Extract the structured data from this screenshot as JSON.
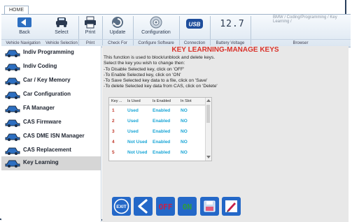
{
  "window": {
    "tab_title": "HOME"
  },
  "ribbon": {
    "buttons": [
      {
        "label": "Back",
        "icon": "back-arrow-icon"
      },
      {
        "label": "Select",
        "icon": "car-icon"
      },
      {
        "label": "Print",
        "icon": "printer-icon"
      },
      {
        "label": "Update",
        "icon": "update-icon"
      },
      {
        "label": "Configuration",
        "icon": "gear-disc-icon"
      }
    ],
    "groups": [
      "Vehicle Navigation",
      "Vehicle Selection",
      "Print",
      "Check For Update",
      "Configure Software",
      "Connection Status",
      "Battery Voltage",
      "Browser"
    ],
    "usb_label": "USB",
    "voltage_text": "12.7",
    "browser_path": "BMW / Coding/Programming / Key Learning /"
  },
  "sidebar": {
    "items": [
      {
        "label": "Indiv Programming"
      },
      {
        "label": "Indiv Coding"
      },
      {
        "label": "Car / Key Memory"
      },
      {
        "label": "Car Configuration"
      },
      {
        "label": "FA Manager"
      },
      {
        "label": "CAS Firmware"
      },
      {
        "label": "CAS DME ISN Manager"
      },
      {
        "label": "CAS Replacement"
      },
      {
        "label": "Key Learning"
      }
    ],
    "active_index": 8
  },
  "main": {
    "title": "KEY LEARNING-MANAGE KEYS",
    "instructions": "This function is used to block/unblock and delete keys.\nSelect the key you wish to change then:\n-To Disable Selected key, click on 'OFF'\n-To Enable Selected key, click on 'ON'\n-To Save Selected key data to a file, click on 'Save'\n-To delete Selected key data from CAS, click on 'Delete'",
    "table": {
      "columns": [
        "Key ...",
        "Is Used",
        "Is Enabled",
        "In Slot"
      ],
      "rows": [
        {
          "key": "1",
          "used": "Used",
          "enabled": "Enabled",
          "slot": "NO"
        },
        {
          "key": "2",
          "used": "Used",
          "enabled": "Enabled",
          "slot": "NO"
        },
        {
          "key": "3",
          "used": "Used",
          "enabled": "Enabled",
          "slot": "NO"
        },
        {
          "key": "4",
          "used": "Not Used",
          "enabled": "Enabled",
          "slot": "NO"
        },
        {
          "key": "5",
          "used": "Not Used",
          "enabled": "Enabled",
          "slot": "NO"
        }
      ]
    },
    "actions": {
      "exit_label": "EXIT",
      "off_label": "OFF",
      "on_label": "ON"
    }
  },
  "colors": {
    "accent": "#2468c8",
    "title_red": "#d9322b",
    "key_red": "#c0392b",
    "cyan": "#1aa6d6",
    "off_red": "#c6204a",
    "on_green": "#2e9e3a"
  }
}
